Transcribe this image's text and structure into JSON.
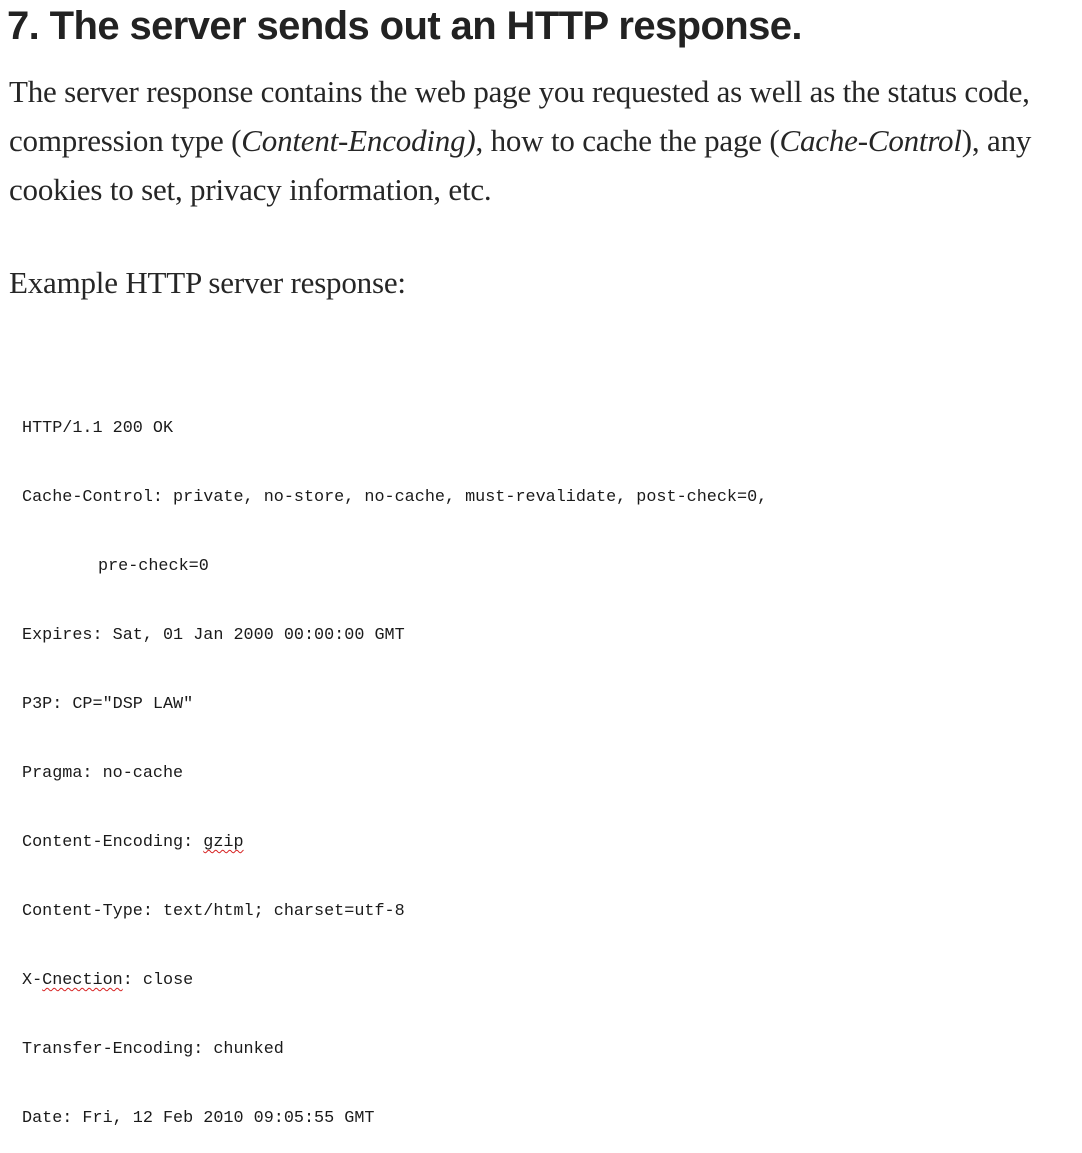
{
  "heading": "7. The server sends out an HTTP response.",
  "paragraph": {
    "part1": "The server response contains the web page you requested as well as the status code, compression type (",
    "em1": "Content-Encoding)",
    "part2": ", how to cache the page (",
    "em2": "Cache-Control",
    "part3": "), any cookies to set, privacy information, etc."
  },
  "example_caption": "Example HTTP server response:",
  "code": {
    "status_line": "HTTP/1.1 200 OK",
    "cache_control": "Cache-Control: private, no-store, no-cache, must-revalidate, post-check=0,",
    "cache_control_cont": "pre-check=0",
    "expires": "Expires: Sat, 01 Jan 2000 00:00:00 GMT",
    "p3p": "P3P: CP=\"DSP LAW\"",
    "pragma": "Pragma: no-cache",
    "content_encoding_key": "Content-Encoding: ",
    "content_encoding_value": "gzip",
    "content_type": "Content-Type: text/html; charset=utf-8",
    "x_prefix": "X-",
    "x_key": "Cnection",
    "x_value": ": close",
    "transfer_encoding": "Transfer-Encoding: chunked",
    "date": "Date: Fri, 12 Feb 2010 09:05:55 GMT"
  },
  "colors": {
    "text": "#222222",
    "spellcheck_underline": "#d62020"
  }
}
